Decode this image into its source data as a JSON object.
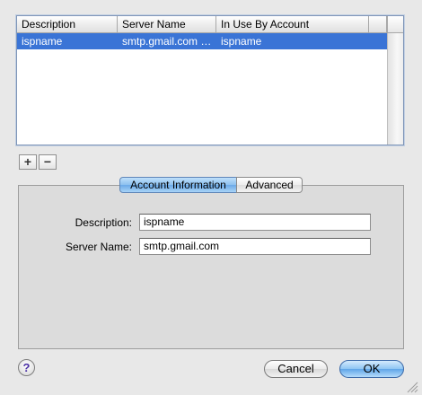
{
  "table": {
    "columns": [
      "Description",
      "Server Name",
      "In Use By Account"
    ],
    "rows": [
      {
        "description": "ispname",
        "server_name": "smtp.gmail.com …",
        "in_use_by": "ispname"
      }
    ]
  },
  "list_buttons": {
    "add": "+",
    "remove": "−"
  },
  "tabs": {
    "account_information": "Account Information",
    "advanced": "Advanced"
  },
  "form": {
    "description_label": "Description:",
    "description_value": "ispname",
    "server_name_label": "Server Name:",
    "server_name_value": "smtp.gmail.com"
  },
  "buttons": {
    "help": "?",
    "cancel": "Cancel",
    "ok": "OK"
  },
  "colors": {
    "selection": "#3a74d6",
    "accent": "#6ba9e8"
  }
}
